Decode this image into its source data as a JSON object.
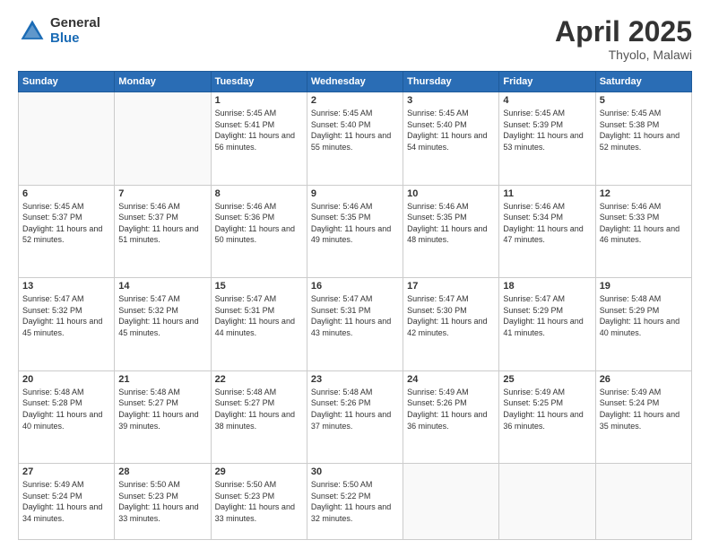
{
  "logo": {
    "general": "General",
    "blue": "Blue"
  },
  "header": {
    "title": "April 2025",
    "location": "Thyolo, Malawi"
  },
  "weekdays": [
    "Sunday",
    "Monday",
    "Tuesday",
    "Wednesday",
    "Thursday",
    "Friday",
    "Saturday"
  ],
  "weeks": [
    [
      {
        "day": "",
        "sunrise": "",
        "sunset": "",
        "daylight": ""
      },
      {
        "day": "",
        "sunrise": "",
        "sunset": "",
        "daylight": ""
      },
      {
        "day": "1",
        "sunrise": "Sunrise: 5:45 AM",
        "sunset": "Sunset: 5:41 PM",
        "daylight": "Daylight: 11 hours and 56 minutes."
      },
      {
        "day": "2",
        "sunrise": "Sunrise: 5:45 AM",
        "sunset": "Sunset: 5:40 PM",
        "daylight": "Daylight: 11 hours and 55 minutes."
      },
      {
        "day": "3",
        "sunrise": "Sunrise: 5:45 AM",
        "sunset": "Sunset: 5:40 PM",
        "daylight": "Daylight: 11 hours and 54 minutes."
      },
      {
        "day": "4",
        "sunrise": "Sunrise: 5:45 AM",
        "sunset": "Sunset: 5:39 PM",
        "daylight": "Daylight: 11 hours and 53 minutes."
      },
      {
        "day": "5",
        "sunrise": "Sunrise: 5:45 AM",
        "sunset": "Sunset: 5:38 PM",
        "daylight": "Daylight: 11 hours and 52 minutes."
      }
    ],
    [
      {
        "day": "6",
        "sunrise": "Sunrise: 5:45 AM",
        "sunset": "Sunset: 5:37 PM",
        "daylight": "Daylight: 11 hours and 52 minutes."
      },
      {
        "day": "7",
        "sunrise": "Sunrise: 5:46 AM",
        "sunset": "Sunset: 5:37 PM",
        "daylight": "Daylight: 11 hours and 51 minutes."
      },
      {
        "day": "8",
        "sunrise": "Sunrise: 5:46 AM",
        "sunset": "Sunset: 5:36 PM",
        "daylight": "Daylight: 11 hours and 50 minutes."
      },
      {
        "day": "9",
        "sunrise": "Sunrise: 5:46 AM",
        "sunset": "Sunset: 5:35 PM",
        "daylight": "Daylight: 11 hours and 49 minutes."
      },
      {
        "day": "10",
        "sunrise": "Sunrise: 5:46 AM",
        "sunset": "Sunset: 5:35 PM",
        "daylight": "Daylight: 11 hours and 48 minutes."
      },
      {
        "day": "11",
        "sunrise": "Sunrise: 5:46 AM",
        "sunset": "Sunset: 5:34 PM",
        "daylight": "Daylight: 11 hours and 47 minutes."
      },
      {
        "day": "12",
        "sunrise": "Sunrise: 5:46 AM",
        "sunset": "Sunset: 5:33 PM",
        "daylight": "Daylight: 11 hours and 46 minutes."
      }
    ],
    [
      {
        "day": "13",
        "sunrise": "Sunrise: 5:47 AM",
        "sunset": "Sunset: 5:32 PM",
        "daylight": "Daylight: 11 hours and 45 minutes."
      },
      {
        "day": "14",
        "sunrise": "Sunrise: 5:47 AM",
        "sunset": "Sunset: 5:32 PM",
        "daylight": "Daylight: 11 hours and 45 minutes."
      },
      {
        "day": "15",
        "sunrise": "Sunrise: 5:47 AM",
        "sunset": "Sunset: 5:31 PM",
        "daylight": "Daylight: 11 hours and 44 minutes."
      },
      {
        "day": "16",
        "sunrise": "Sunrise: 5:47 AM",
        "sunset": "Sunset: 5:31 PM",
        "daylight": "Daylight: 11 hours and 43 minutes."
      },
      {
        "day": "17",
        "sunrise": "Sunrise: 5:47 AM",
        "sunset": "Sunset: 5:30 PM",
        "daylight": "Daylight: 11 hours and 42 minutes."
      },
      {
        "day": "18",
        "sunrise": "Sunrise: 5:47 AM",
        "sunset": "Sunset: 5:29 PM",
        "daylight": "Daylight: 11 hours and 41 minutes."
      },
      {
        "day": "19",
        "sunrise": "Sunrise: 5:48 AM",
        "sunset": "Sunset: 5:29 PM",
        "daylight": "Daylight: 11 hours and 40 minutes."
      }
    ],
    [
      {
        "day": "20",
        "sunrise": "Sunrise: 5:48 AM",
        "sunset": "Sunset: 5:28 PM",
        "daylight": "Daylight: 11 hours and 40 minutes."
      },
      {
        "day": "21",
        "sunrise": "Sunrise: 5:48 AM",
        "sunset": "Sunset: 5:27 PM",
        "daylight": "Daylight: 11 hours and 39 minutes."
      },
      {
        "day": "22",
        "sunrise": "Sunrise: 5:48 AM",
        "sunset": "Sunset: 5:27 PM",
        "daylight": "Daylight: 11 hours and 38 minutes."
      },
      {
        "day": "23",
        "sunrise": "Sunrise: 5:48 AM",
        "sunset": "Sunset: 5:26 PM",
        "daylight": "Daylight: 11 hours and 37 minutes."
      },
      {
        "day": "24",
        "sunrise": "Sunrise: 5:49 AM",
        "sunset": "Sunset: 5:26 PM",
        "daylight": "Daylight: 11 hours and 36 minutes."
      },
      {
        "day": "25",
        "sunrise": "Sunrise: 5:49 AM",
        "sunset": "Sunset: 5:25 PM",
        "daylight": "Daylight: 11 hours and 36 minutes."
      },
      {
        "day": "26",
        "sunrise": "Sunrise: 5:49 AM",
        "sunset": "Sunset: 5:24 PM",
        "daylight": "Daylight: 11 hours and 35 minutes."
      }
    ],
    [
      {
        "day": "27",
        "sunrise": "Sunrise: 5:49 AM",
        "sunset": "Sunset: 5:24 PM",
        "daylight": "Daylight: 11 hours and 34 minutes."
      },
      {
        "day": "28",
        "sunrise": "Sunrise: 5:50 AM",
        "sunset": "Sunset: 5:23 PM",
        "daylight": "Daylight: 11 hours and 33 minutes."
      },
      {
        "day": "29",
        "sunrise": "Sunrise: 5:50 AM",
        "sunset": "Sunset: 5:23 PM",
        "daylight": "Daylight: 11 hours and 33 minutes."
      },
      {
        "day": "30",
        "sunrise": "Sunrise: 5:50 AM",
        "sunset": "Sunset: 5:22 PM",
        "daylight": "Daylight: 11 hours and 32 minutes."
      },
      {
        "day": "",
        "sunrise": "",
        "sunset": "",
        "daylight": ""
      },
      {
        "day": "",
        "sunrise": "",
        "sunset": "",
        "daylight": ""
      },
      {
        "day": "",
        "sunrise": "",
        "sunset": "",
        "daylight": ""
      }
    ]
  ]
}
